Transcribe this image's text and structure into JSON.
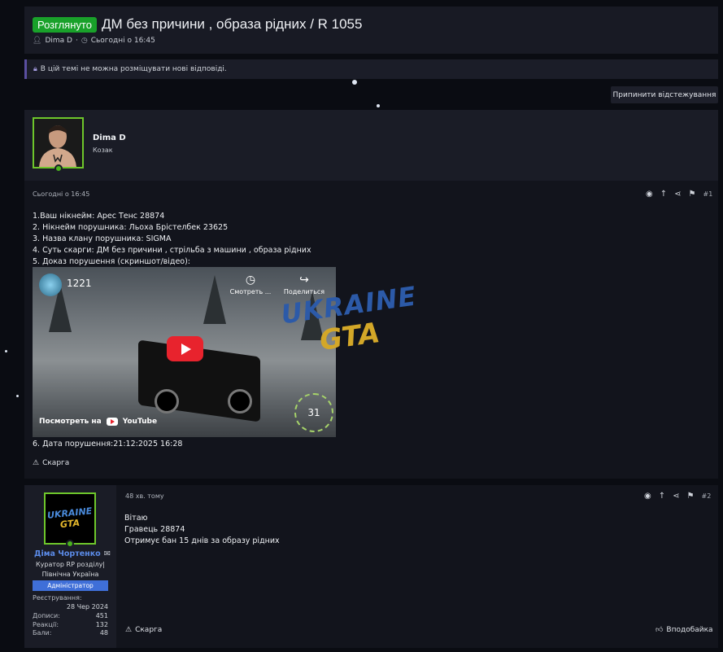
{
  "thread": {
    "prefix": "Розглянуто",
    "title": "ДМ без причини , образа рідних / R 1055",
    "author": "Dima D",
    "date": "Сьогодні о 16:45",
    "notice": "В цій темі не можна розміщувати нові відповіді.",
    "unwatch_label": "Припинити відстежування"
  },
  "post1": {
    "username": "Dima D",
    "user_title": "Козак",
    "date": "Сьогодні о 16:45",
    "number": "#1",
    "lines": [
      "1.Ваш нікнейм: Арес Тенс 28874",
      "2. Нікнейм порушника: Льоха Брістелбек 23625",
      "3. Назва клану порушника: SIGMA",
      "4. Суть скарги: ДМ без причини , стрільба з машини , образа рідних",
      "5. Доказ порушення (скриншот/відео):"
    ],
    "video": {
      "count": "1221",
      "watch_later": "Смотреть ...",
      "share": "Поделиться",
      "watch_on": "Посмотреть на",
      "youtube": "YouTube",
      "speed": "31"
    },
    "date_line": "6. Дата порушення:21:12:2025 16:28",
    "report_label": "Скарга"
  },
  "watermark": {
    "line1": "UKRAINE",
    "line2": "GTA"
  },
  "post2": {
    "username": "Діма Чортенко",
    "user_title": "Куратор RP розділу| Північна Україна",
    "badge": "Адміністратор",
    "logo_line1": "UKRAINE",
    "logo_line2": "GTA",
    "stats": [
      {
        "label": "Реєстрування:",
        "value": ""
      },
      {
        "label": "",
        "value": "28 Чер 2024"
      },
      {
        "label": "Дописи:",
        "value": "451"
      },
      {
        "label": "Реакції:",
        "value": "132"
      },
      {
        "label": "Бали:",
        "value": "48"
      }
    ],
    "date": "48 хв. тому",
    "number": "#2",
    "lines": [
      "Вітаю",
      "Гравець 28874",
      "Отримує бан 15 днів за образу рідних"
    ],
    "report_label": "Скарга",
    "like_label": "Вподобайка"
  },
  "icons": {
    "lock": "lock-icon",
    "user": "user-icon",
    "clock": "clock-icon",
    "warning": "warning-icon",
    "bookmark": "bookmark-icon",
    "share": "share-icon",
    "arrow_up": "arrow-up-icon",
    "reaction": "reaction-icon",
    "envelope": "envelope-icon",
    "thumb": "thumb-icon"
  },
  "colors": {
    "prefix_bg": "#19a12a",
    "online": "#4ab21e",
    "avatar_border": "#6ec62b",
    "admin_badge": "#3f6fd8",
    "admin_name": "#5b8be8"
  }
}
